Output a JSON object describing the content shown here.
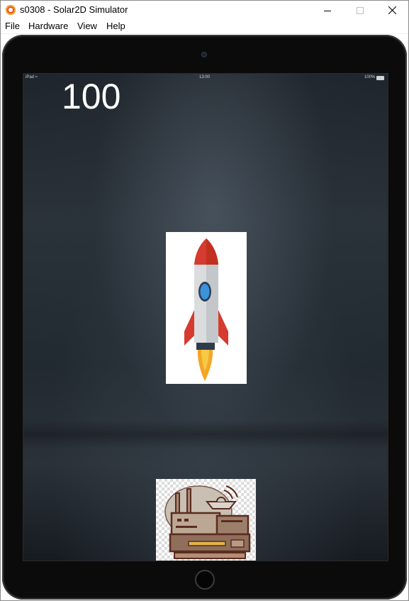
{
  "window": {
    "title": "s0308 - Solar2D Simulator",
    "minimize_icon": "minimize-icon",
    "maximize_icon": "maximize-icon",
    "close_icon": "close-icon"
  },
  "menu": {
    "items": [
      {
        "label": "File"
      },
      {
        "label": "Hardware"
      },
      {
        "label": "View"
      },
      {
        "label": "Help"
      }
    ]
  },
  "device": {
    "model": "iPad",
    "status_left": "iPad ≈",
    "status_time": "13:00",
    "status_right": "100%",
    "frame_color": "#0b0b0b"
  },
  "game": {
    "score": "100",
    "sprites": [
      {
        "name": "rocket",
        "icon": "rocket-icon"
      },
      {
        "name": "building",
        "icon": "building-icon"
      }
    ]
  },
  "colors": {
    "rocket_red": "#d63b2f",
    "rocket_body": "#d8dadc",
    "rocket_window": "#2f8fd8",
    "flame": "#f5a623",
    "building_brown": "#5b2c1f"
  }
}
